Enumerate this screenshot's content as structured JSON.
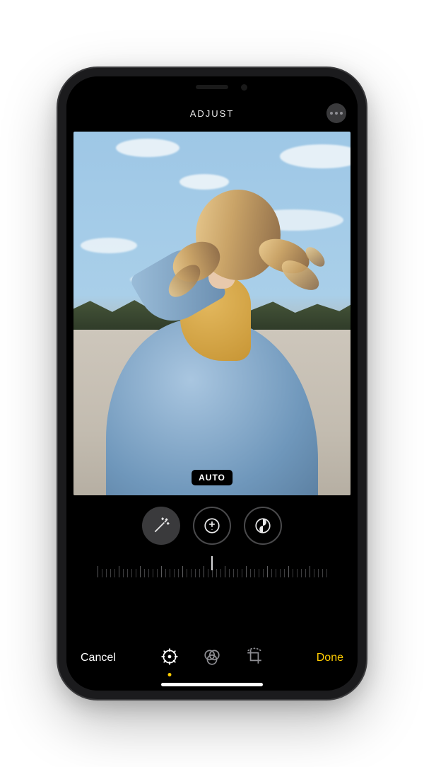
{
  "header": {
    "title": "ADJUST"
  },
  "toolPill": "AUTO",
  "adjustTools": [
    {
      "id": "auto",
      "icon": "wand-icon",
      "active": true
    },
    {
      "id": "exposure",
      "icon": "exposure-icon",
      "active": false
    },
    {
      "id": "brilliance",
      "icon": "yin-yang-icon",
      "active": false
    }
  ],
  "bottom": {
    "cancel": "Cancel",
    "done": "Done"
  },
  "modes": [
    {
      "id": "adjust",
      "icon": "adjust-dial-icon",
      "active": true
    },
    {
      "id": "filters",
      "icon": "filters-icon",
      "active": false
    },
    {
      "id": "crop",
      "icon": "crop-icon",
      "active": false
    }
  ]
}
